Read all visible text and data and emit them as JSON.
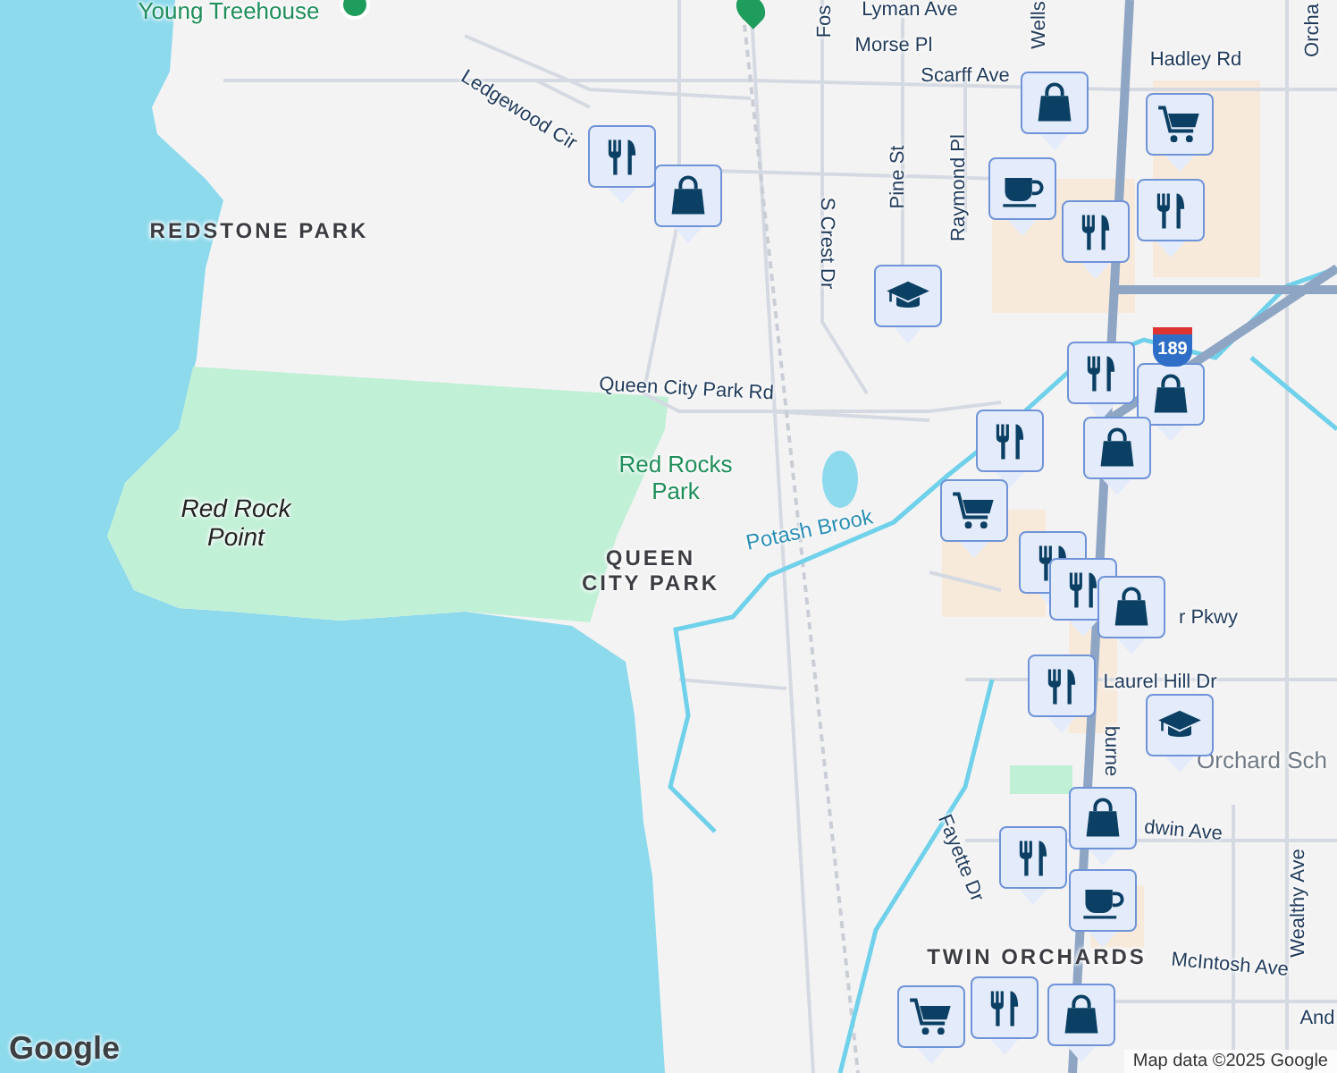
{
  "map": {
    "labels": [
      {
        "text": "Young Treehouse",
        "kind": "poi-green"
      },
      {
        "text": "Ledgewood Cir",
        "kind": "street"
      },
      {
        "text": "REDSTONE PARK",
        "kind": "place"
      },
      {
        "text": "Red Rock Point",
        "kind": "natural"
      },
      {
        "text": "Red Rocks Park",
        "kind": "park"
      },
      {
        "text": "QUEEN CITY PARK",
        "kind": "place"
      },
      {
        "text": "Queen City Park Rd",
        "kind": "street"
      },
      {
        "text": "Potash Brook",
        "kind": "water"
      },
      {
        "text": "S Crest Dr",
        "kind": "street"
      },
      {
        "text": "Pine St",
        "kind": "street"
      },
      {
        "text": "Raymond Pl",
        "kind": "street"
      },
      {
        "text": "Fos",
        "kind": "street"
      },
      {
        "text": "Lyman Ave",
        "kind": "street"
      },
      {
        "text": "Wells",
        "kind": "street"
      },
      {
        "text": "Morse Pl",
        "kind": "street"
      },
      {
        "text": "Hadley Rd",
        "kind": "street"
      },
      {
        "text": "Orcha",
        "kind": "street"
      },
      {
        "text": "Scarff Ave",
        "kind": "street"
      },
      {
        "text": "r Pkwy",
        "kind": "street"
      },
      {
        "text": "Laurel Hill Dr",
        "kind": "street"
      },
      {
        "text": "Orchard Sch",
        "kind": "poi"
      },
      {
        "text": "burne",
        "kind": "street"
      },
      {
        "text": "dwin Ave",
        "kind": "street"
      },
      {
        "text": "Fayette Dr",
        "kind": "street"
      },
      {
        "text": "TWIN ORCHARDS",
        "kind": "place"
      },
      {
        "text": "Wealthy Ave",
        "kind": "street"
      },
      {
        "text": "McIntosh Ave",
        "kind": "street"
      },
      {
        "text": "And",
        "kind": "street"
      }
    ],
    "markers": [
      {
        "kind": "restaurant"
      },
      {
        "kind": "shopping"
      },
      {
        "kind": "shopping"
      },
      {
        "kind": "cafe"
      },
      {
        "kind": "grocery"
      },
      {
        "kind": "restaurant"
      },
      {
        "kind": "restaurant"
      },
      {
        "kind": "school"
      },
      {
        "kind": "restaurant"
      },
      {
        "kind": "shopping"
      },
      {
        "kind": "shopping"
      },
      {
        "kind": "restaurant"
      },
      {
        "kind": "grocery"
      },
      {
        "kind": "restaurant"
      },
      {
        "kind": "restaurant"
      },
      {
        "kind": "shopping"
      },
      {
        "kind": "restaurant"
      },
      {
        "kind": "school"
      },
      {
        "kind": "shopping"
      },
      {
        "kind": "restaurant"
      },
      {
        "kind": "cafe"
      },
      {
        "kind": "grocery"
      },
      {
        "kind": "restaurant"
      },
      {
        "kind": "shopping"
      }
    ]
  },
  "highway_shield": "189",
  "logo": "Google",
  "attribution": "Map data ©2025 Google"
}
